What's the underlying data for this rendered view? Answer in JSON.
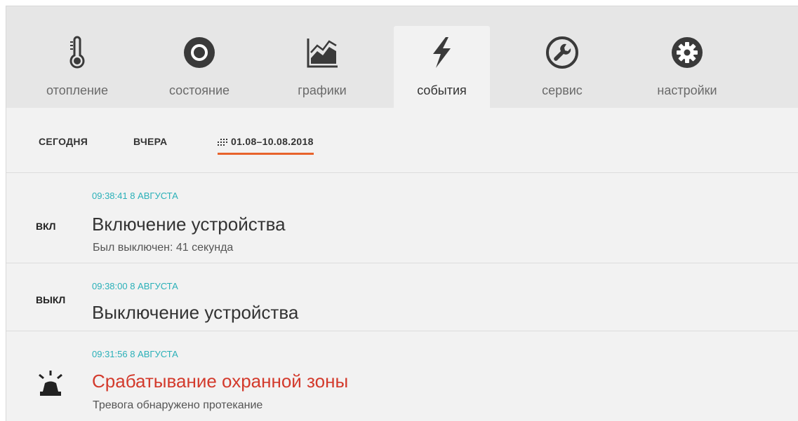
{
  "tabs": [
    {
      "label": "отопление",
      "icon": "thermometer-icon"
    },
    {
      "label": "состояние",
      "icon": "status-circle-icon"
    },
    {
      "label": "графики",
      "icon": "chart-icon"
    },
    {
      "label": "события",
      "icon": "lightning-icon",
      "active": true
    },
    {
      "label": "сервис",
      "icon": "wrench-icon"
    },
    {
      "label": "настройки",
      "icon": "gear-icon"
    }
  ],
  "filters": {
    "today": "СЕГОДНЯ",
    "yesterday": "ВЧЕРА",
    "range": "01.08–10.08.2018"
  },
  "events": [
    {
      "badge": "ВКЛ",
      "time": "09:38:41 8 АВГУСТА",
      "title": "Включение устройства",
      "subtitle": "Был выключен: 41 секунда"
    },
    {
      "badge": "ВЫКЛ",
      "time": "09:38:00 8 АВГУСТА",
      "title": "Выключение устройства"
    },
    {
      "icon": "siren-icon",
      "time": "09:31:56 8 АВГУСТА",
      "title": "Срабатывание охранной зоны",
      "subtitle": "Тревога обнаружено протекание"
    }
  ],
  "colors": {
    "accent": "#e8632c",
    "time": "#2ab0b8",
    "alarm": "#d33a2c"
  }
}
